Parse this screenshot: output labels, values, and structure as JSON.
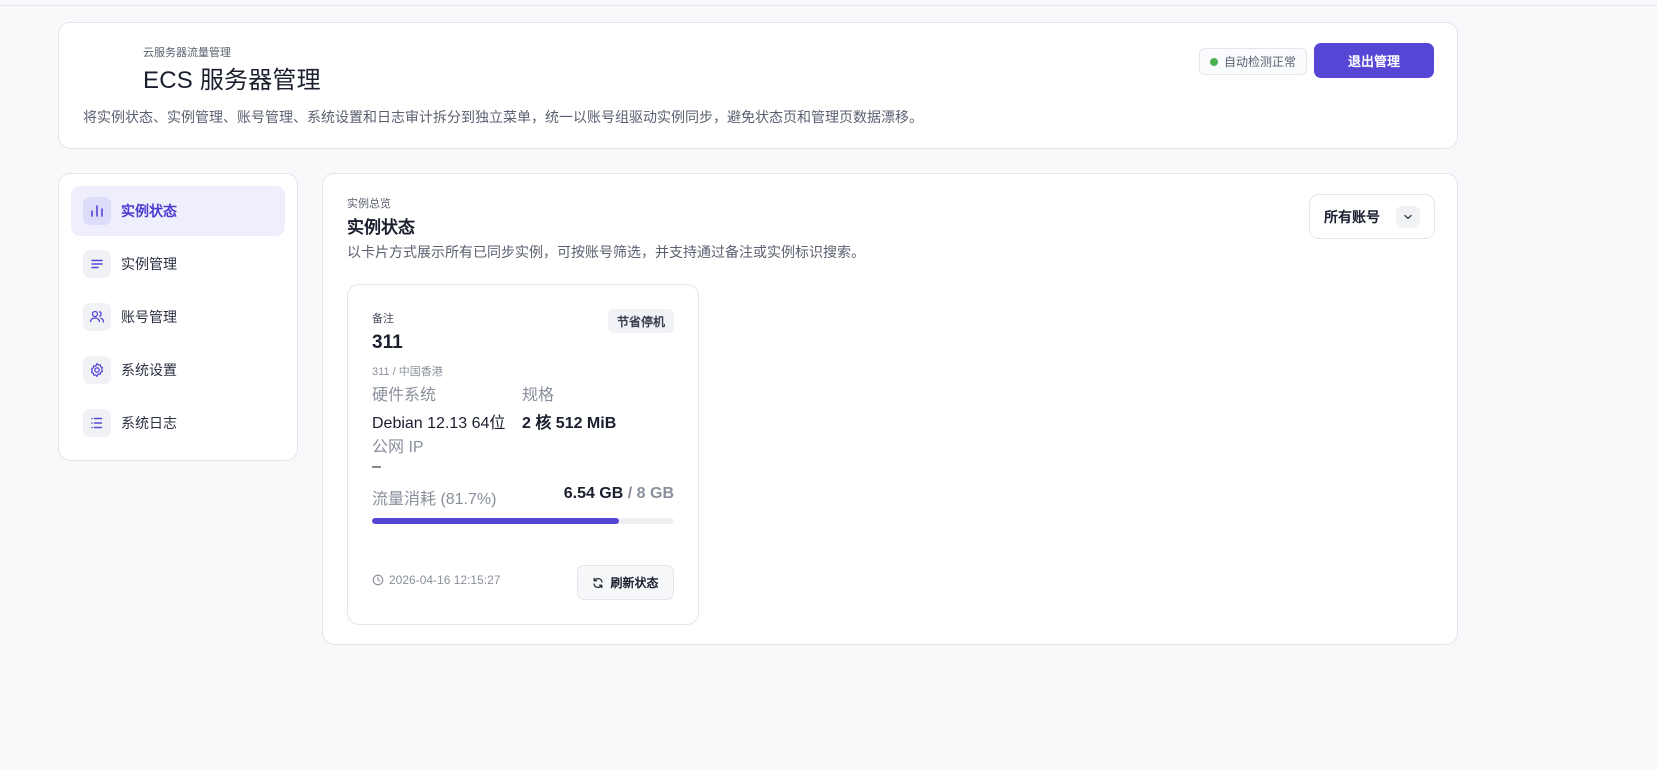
{
  "header": {
    "eyebrow": "云服务器流量管理",
    "title": "ECS 服务器管理",
    "description": "将实例状态、实例管理、账号管理、系统设置和日志审计拆分到独立菜单，统一以账号组驱动实例同步，避免状态页和管理页数据漂移。",
    "status_text": "自动检测正常",
    "status_color": "#4caf50",
    "exit_label": "退出管理"
  },
  "sidebar": {
    "items": [
      {
        "label": "实例状态",
        "icon": "bar-chart-icon",
        "active": true
      },
      {
        "label": "实例管理",
        "icon": "list-icon",
        "active": false
      },
      {
        "label": "账号管理",
        "icon": "users-icon",
        "active": false
      },
      {
        "label": "系统设置",
        "icon": "gear-icon",
        "active": false
      },
      {
        "label": "系统日志",
        "icon": "log-list-icon",
        "active": false
      }
    ]
  },
  "main": {
    "eyebrow": "实例总览",
    "title": "实例状态",
    "description": "以卡片方式展示所有已同步实例，可按账号筛选，并支持通过备注或实例标识搜索。",
    "account_filter": "所有账号"
  },
  "instance": {
    "remark_label": "备注",
    "name": "311",
    "subtitle": "311 / 中国香港",
    "badge": "节省停机",
    "os_label": "硬件系统",
    "os_value": "Debian 12.13 64位",
    "spec_label": "规格",
    "spec_value": "2 核 512 MiB",
    "ip_label": "公网 IP",
    "ip_value": "–",
    "traffic_label": "流量消耗 (81.7%)",
    "traffic_used": "6.54 GB",
    "traffic_total": " / 8 GB",
    "traffic_fraction": 0.817,
    "timestamp": "2026-04-16 12:15:27",
    "refresh_label": "刷新状态"
  },
  "colors": {
    "accent": "#5546d6",
    "active_bg": "#eeeefd"
  }
}
